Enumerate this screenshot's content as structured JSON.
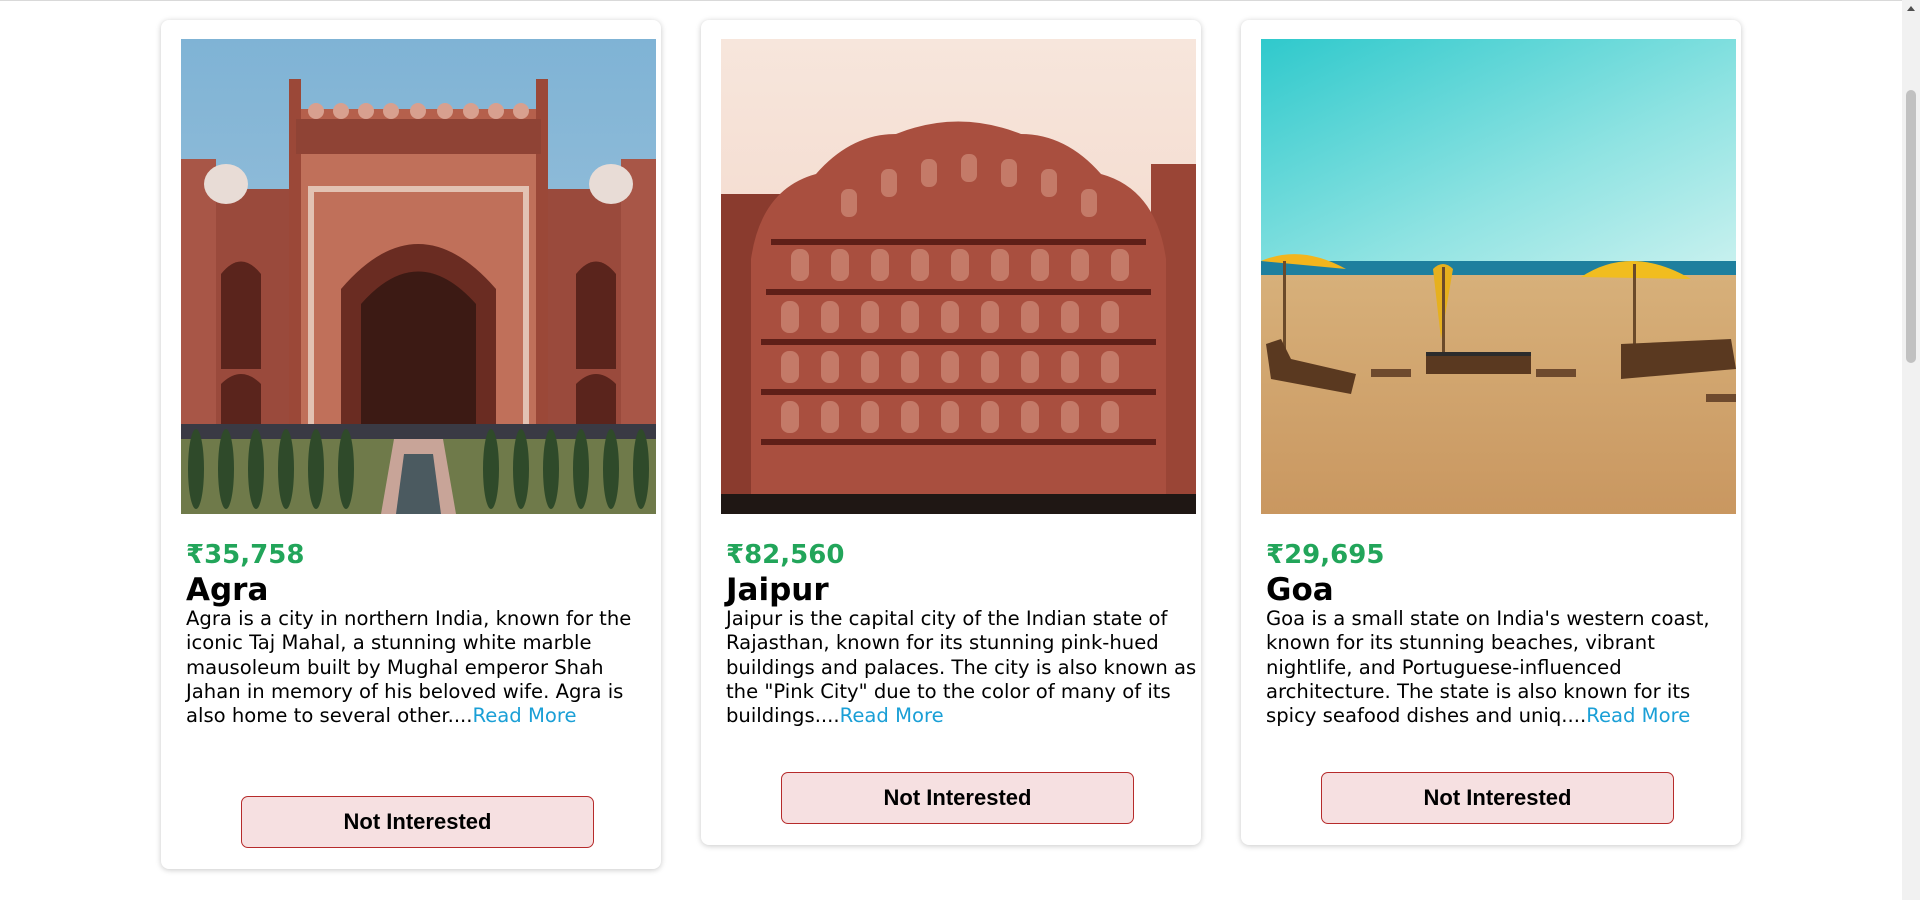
{
  "currency_symbol": "₹",
  "destinations": [
    {
      "price": "₹35,758",
      "name": "Agra",
      "description": "Agra is a city in northern India, known for the iconic Taj Mahal, a stunning white marble mausoleum built by Mughal emperor Shah Jahan in memory of his beloved wife. Agra is also home to several other....",
      "read_more_label": "Read More",
      "button_label": "Not Interested",
      "image_icon": "taj-mahal-gate-photo"
    },
    {
      "price": "₹82,560",
      "name": "Jaipur",
      "description": "Jaipur is the capital city of the Indian state of Rajasthan, known for its stunning pink-hued buildings and palaces. The city is also known as the \"Pink City\" due to the color of many of its buildings....",
      "read_more_label": "Read More",
      "button_label": "Not Interested",
      "image_icon": "hawa-mahal-photo"
    },
    {
      "price": "₹29,695",
      "name": "Goa",
      "description": "Goa is a small state on India's western coast, known for its stunning beaches, vibrant nightlife, and Portuguese-influenced architecture. The state is also known for its spicy seafood dishes and uniq....",
      "read_more_label": "Read More",
      "button_label": "Not Interested",
      "image_icon": "goa-beach-photo"
    }
  ],
  "colors": {
    "price": "#22a55a",
    "link": "#1a9fd6",
    "button_bg": "#f6e0e1",
    "button_border": "#b62b2b"
  }
}
